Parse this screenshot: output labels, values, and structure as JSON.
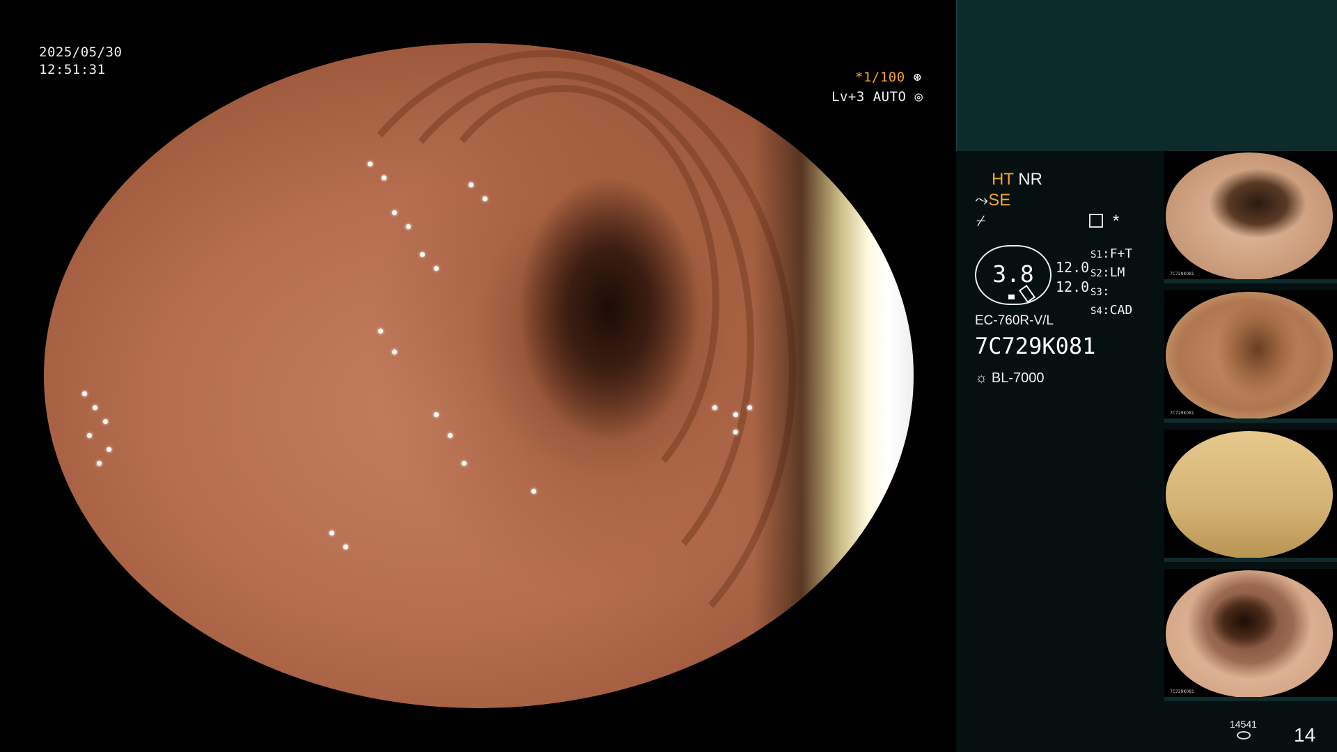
{
  "overlay": {
    "date": "2025/05/30",
    "time": "12:51:31",
    "shutter": "*1/100",
    "level": "Lv+3",
    "mode": "AUTO"
  },
  "panel": {
    "ht": "HT",
    "nr": "NR",
    "se": "SE",
    "asterisk": "*",
    "gauge_value": "3.8",
    "gauge_val1": "12.0",
    "gauge_val2": "12.0",
    "switches": [
      {
        "key": "S1",
        "value": "F+T"
      },
      {
        "key": "S2",
        "value": "LM"
      },
      {
        "key": "S3",
        "value": ""
      },
      {
        "key": "S4",
        "value": "CAD"
      }
    ],
    "scope_model": "EC-760R-V/L",
    "scope_serial": "7C729K081",
    "light_source": "BL-7000",
    "record_count": "14541",
    "image_count": "14"
  },
  "thumbnails": [
    {
      "label": "7C729K081",
      "type": "lumen-dark"
    },
    {
      "label": "7C729K081",
      "type": "folds"
    },
    {
      "label": "",
      "type": "washout"
    },
    {
      "label": "7C729K081",
      "type": "lumen-deep"
    }
  ],
  "colors": {
    "accent_orange": "#f2a531",
    "panel_top": "#0c2b2b",
    "panel_body": "#061010"
  }
}
